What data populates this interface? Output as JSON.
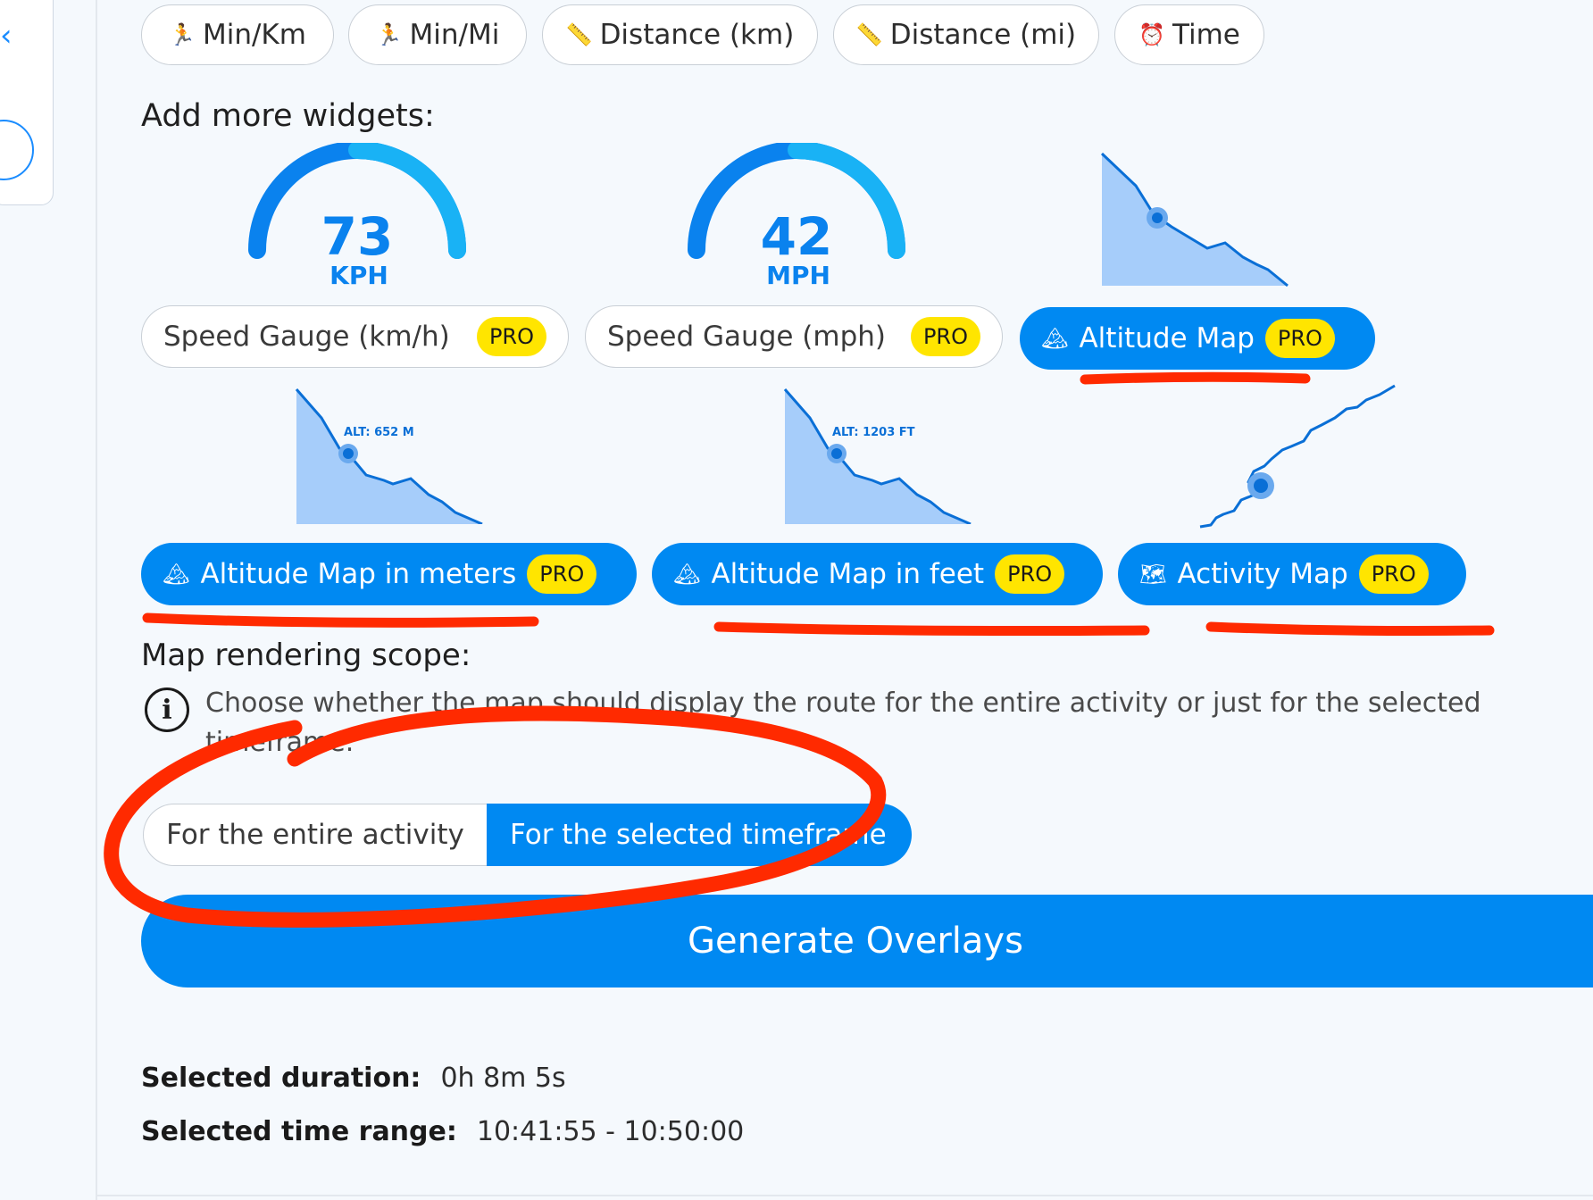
{
  "top_chips": [
    {
      "icon": "runner-icon",
      "glyph": "🏃",
      "label": "Min/Km"
    },
    {
      "icon": "runner-icon",
      "glyph": "🏃",
      "label": "Min/Mi"
    },
    {
      "icon": "ruler-icon",
      "glyph": "📏",
      "label": "Distance (km)"
    },
    {
      "icon": "ruler-icon",
      "glyph": "📏",
      "label": "Distance (mi)"
    },
    {
      "icon": "alarm-clock-icon",
      "glyph": "⏰",
      "label": "Time"
    }
  ],
  "add_widgets_label": "Add more widgets:",
  "gauges": [
    {
      "value": "73",
      "unit": "KPH"
    },
    {
      "value": "42",
      "unit": "MPH"
    }
  ],
  "alt_previews": [
    {
      "label": "ALT: 652 M"
    },
    {
      "label": "ALT: 1203 FT"
    }
  ],
  "widgets": [
    {
      "label": "Speed Gauge (km/h)",
      "badge": "PRO",
      "selected": false
    },
    {
      "label": "Speed Gauge (mph)",
      "badge": "PRO",
      "selected": false
    },
    {
      "label": "Altitude Map",
      "badge": "PRO",
      "selected": true,
      "icon": "mountain-icon",
      "glyph": "🏔"
    },
    {
      "label": "Altitude Map in meters",
      "badge": "PRO",
      "selected": true,
      "icon": "mountain-icon",
      "glyph": "🏔"
    },
    {
      "label": "Altitude Map in feet",
      "badge": "PRO",
      "selected": true,
      "icon": "mountain-icon",
      "glyph": "🏔"
    },
    {
      "label": "Activity Map",
      "badge": "PRO",
      "selected": true,
      "icon": "map-icon",
      "glyph": "🗺"
    }
  ],
  "map_scope": {
    "label": "Map rendering scope:",
    "info": "Choose whether the map should display the route for the entire activity or just for the selected timeframe.",
    "options": [
      "For the entire activity",
      "For the selected timeframe"
    ],
    "selected": "For the selected timeframe"
  },
  "generate_label": "Generate Overlays",
  "summary": {
    "duration_label": "Selected duration:",
    "duration_value": "0h 8m 5s",
    "range_label": "Selected time range:",
    "range_value": "10:41:55 - 10:50:00"
  },
  "colors": {
    "accent": "#0089f2",
    "badge": "#ffe500",
    "annotation": "#ff2a00"
  }
}
